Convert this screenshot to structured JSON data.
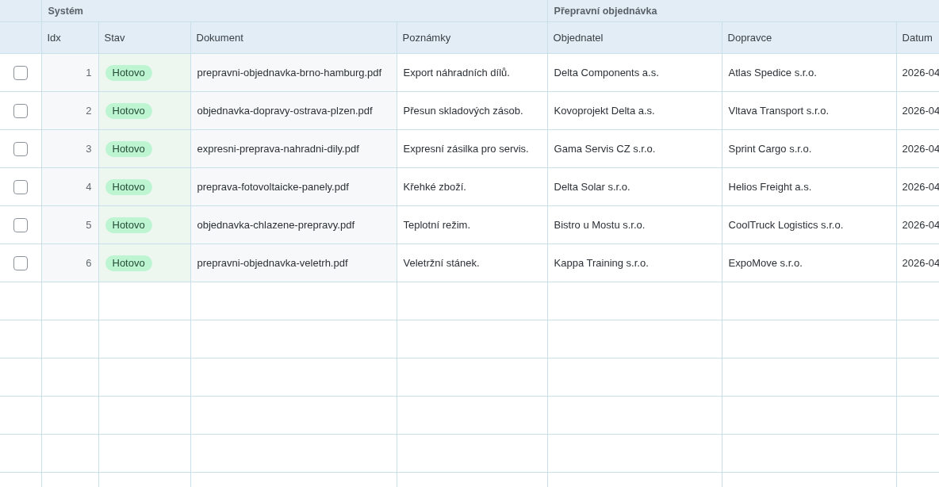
{
  "table": {
    "column_groups": [
      {
        "label": "Systém",
        "columns": [
          "Idx",
          "Stav",
          "Dokument",
          "Poznámky"
        ]
      },
      {
        "label": "Přepravní objednávka",
        "columns": [
          "Objednatel",
          "Dopravce",
          "Datum"
        ]
      }
    ],
    "rows": [
      {
        "checked": false,
        "idx": "1",
        "status": "Hotovo",
        "document": "prepravni-objednavka-brno-hamburg.pdf",
        "notes": "Export náhradních dílů.",
        "customer": "Delta Components a.s.",
        "carrier": "Atlas Spedice s.r.o.",
        "date": "2026-04"
      },
      {
        "checked": false,
        "idx": "2",
        "status": "Hotovo",
        "document": "objednavka-dopravy-ostrava-plzen.pdf",
        "notes": "Přesun skladových zásob.",
        "customer": "Kovoprojekt Delta a.s.",
        "carrier": "Vltava Transport s.r.o.",
        "date": "2026-04"
      },
      {
        "checked": false,
        "idx": "3",
        "status": "Hotovo",
        "document": "expresni-preprava-nahradni-dily.pdf",
        "notes": "Expresní zásilka pro servis.",
        "customer": "Gama Servis CZ s.r.o.",
        "carrier": "Sprint Cargo s.r.o.",
        "date": "2026-04"
      },
      {
        "checked": false,
        "idx": "4",
        "status": "Hotovo",
        "document": "preprava-fotovoltaicke-panely.pdf",
        "notes": "Křehké zboží.",
        "customer": "Delta Solar s.r.o.",
        "carrier": "Helios Freight a.s.",
        "date": "2026-04"
      },
      {
        "checked": false,
        "idx": "5",
        "status": "Hotovo",
        "document": "objednavka-chlazene-prepravy.pdf",
        "notes": "Teplotní režim.",
        "customer": "Bistro u Mostu s.r.o.",
        "carrier": "CoolTruck Logistics s.r.o.",
        "date": "2026-04"
      },
      {
        "checked": false,
        "idx": "6",
        "status": "Hotovo",
        "document": "prepravni-objednavka-veletrh.pdf",
        "notes": "Veletržní stánek.",
        "customer": "Kappa Training s.r.o.",
        "carrier": "ExpoMove s.r.o.",
        "date": "2026-04"
      }
    ]
  }
}
